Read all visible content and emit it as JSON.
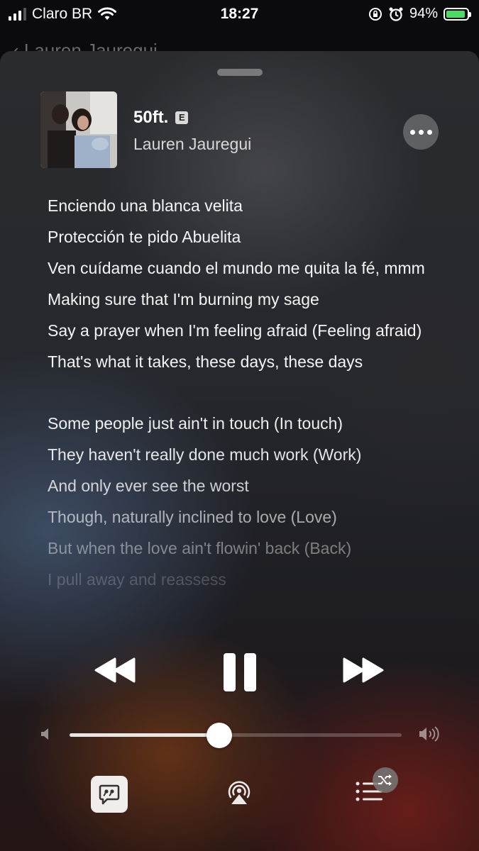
{
  "status_bar": {
    "carrier": "Claro BR",
    "time": "18:27",
    "battery_percent": "94%",
    "battery_level": 0.94,
    "signal_bars": 3
  },
  "background_page": {
    "title": "Lauren Jauregui"
  },
  "now_playing": {
    "title": "50ft.",
    "explicit_badge": "E",
    "artist": "Lauren Jauregui"
  },
  "lyrics": {
    "stanza1": [
      "Enciendo una blanca velita",
      "Protección te pido Abuelita",
      "Ven cuídame cuando el mundo me quita la fé, mmm",
      "Making sure that I'm burning my sage",
      "Say a prayer when I'm feeling afraid (Feeling afraid)",
      "That's what it takes, these days, these days"
    ],
    "stanza2": [
      "Some people just ain't in touch (In touch)",
      "They haven't really done much work (Work)",
      "And only ever see the worst",
      "Though, naturally inclined to love (Love)",
      "But when the love ain't flowin' back (Back)",
      "I pull away and reassess"
    ]
  },
  "controls": {
    "rewind_icon": "rewind-icon",
    "pause_icon": "pause-icon",
    "forward_icon": "fast-forward-icon"
  },
  "volume": {
    "level": 0.45
  },
  "toolbar": {
    "lyrics_icon": "quote-bubble-icon",
    "airplay_icon": "airplay-icon",
    "queue_icon": "list-icon",
    "shuffle_icon": "shuffle-icon"
  }
}
